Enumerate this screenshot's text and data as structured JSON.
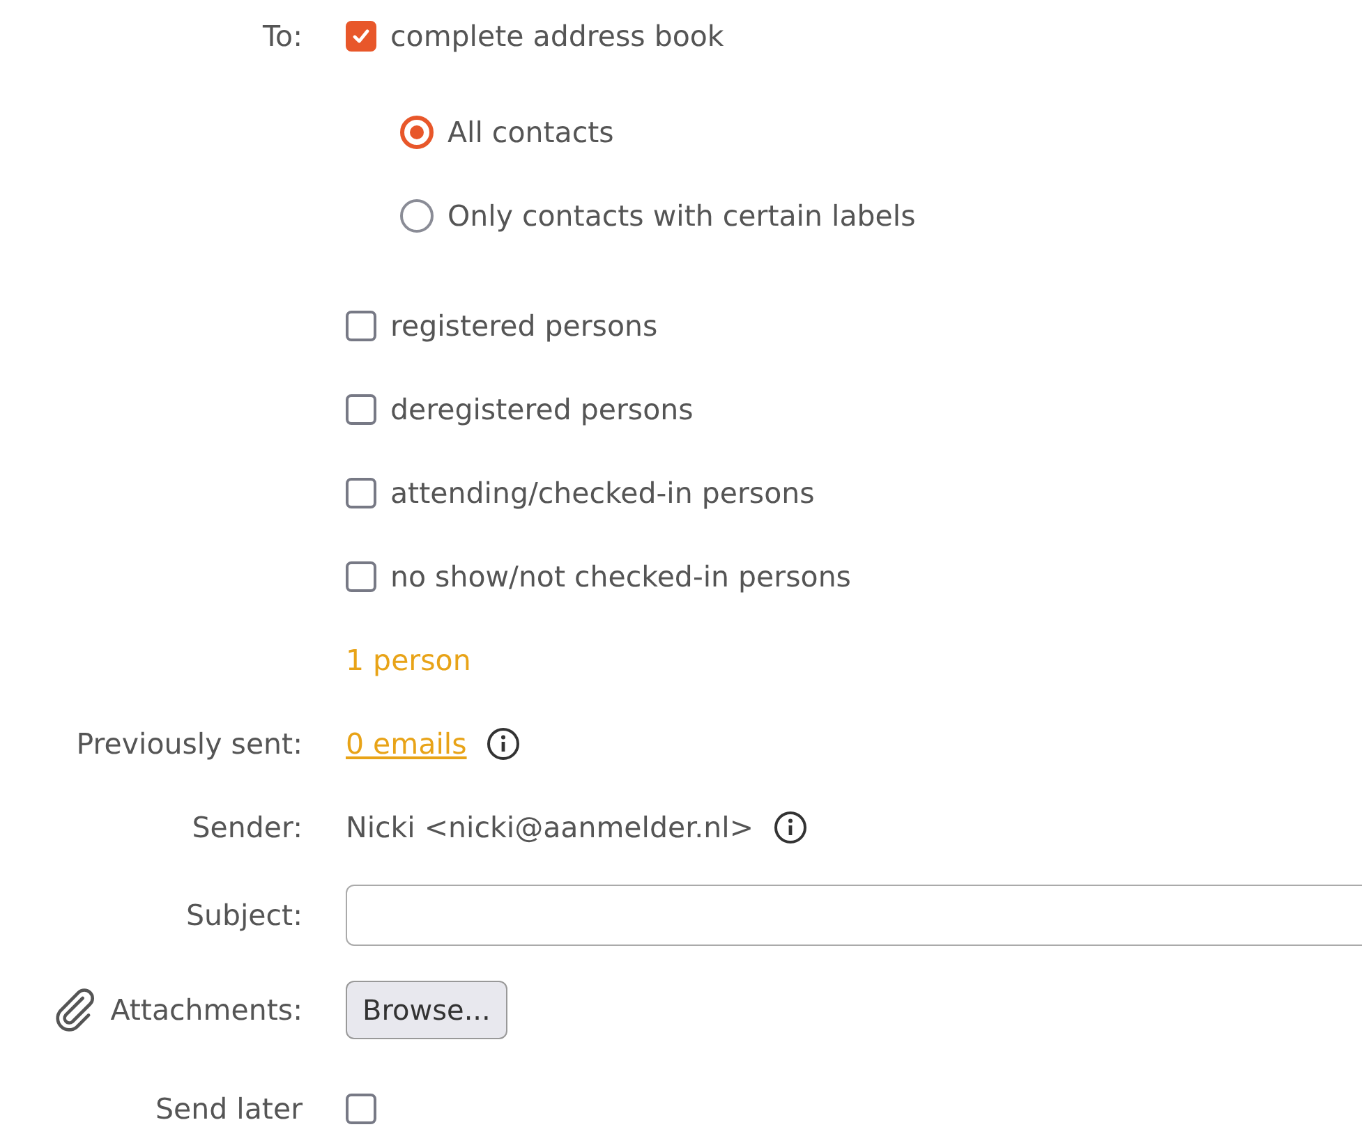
{
  "to": {
    "label": "To:",
    "checkbox": {
      "label": "complete address book",
      "checked": true
    },
    "radios": [
      {
        "label": "All contacts",
        "selected": true
      },
      {
        "label": "Only contacts with certain labels",
        "selected": false
      }
    ],
    "filters": [
      {
        "label": "registered persons",
        "checked": false
      },
      {
        "label": "deregistered persons",
        "checked": false
      },
      {
        "label": "attending/checked-in persons",
        "checked": false
      },
      {
        "label": "no show/not checked-in persons",
        "checked": false
      }
    ],
    "count": "1 person"
  },
  "previously_sent": {
    "label": "Previously sent:",
    "link": "0 emails"
  },
  "sender": {
    "label": "Sender:",
    "value": "Nicki <nicki@aanmelder.nl>"
  },
  "subject": {
    "label": "Subject:"
  },
  "attachments": {
    "label": "Attachments:",
    "button": "Browse..."
  },
  "send_later": {
    "label": "Send later",
    "checked": false
  }
}
